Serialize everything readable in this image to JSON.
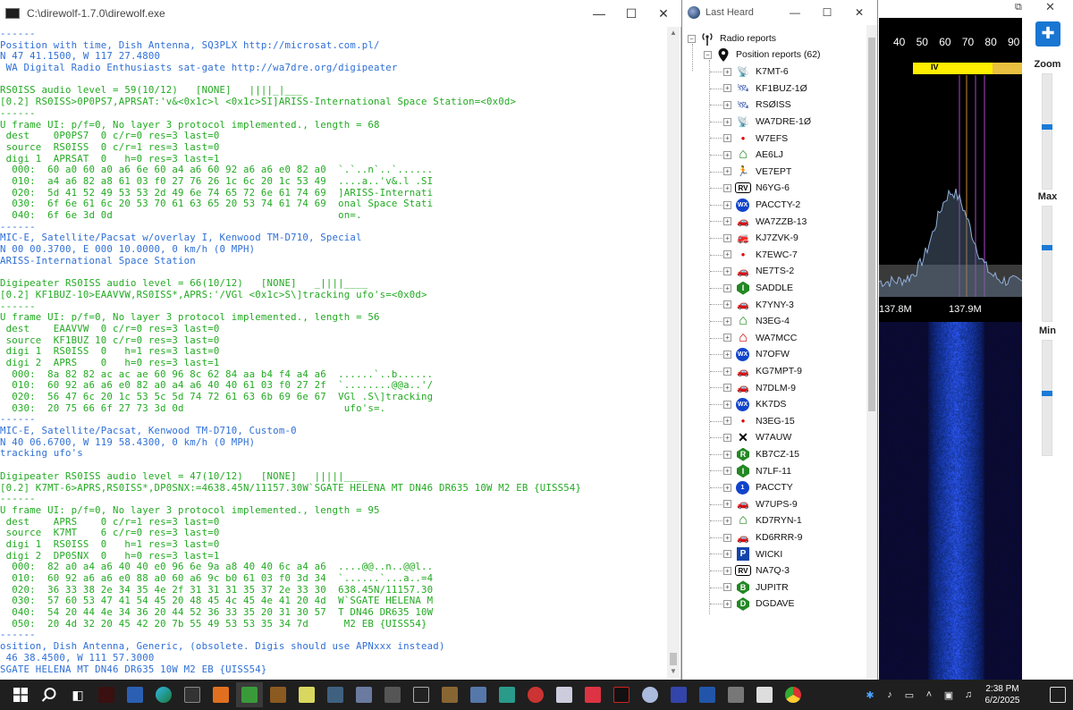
{
  "console": {
    "title": "C:\\direwolf-1.7.0\\direwolf.exe",
    "lines": [
      {
        "t": "------",
        "c": "blue"
      },
      {
        "t": "Position with time, Dish Antenna, SQ3PLX http://microsat.com.pl/",
        "c": "blue"
      },
      {
        "t": "N 47 41.1500, W 117 27.4800",
        "c": "blue"
      },
      {
        "t": " WA Digital Radio Enthusiasts sat-gate http://wa7dre.org/digipeater",
        "c": "blue"
      },
      {
        "t": "",
        "c": "blue"
      },
      {
        "t": "RS0ISS audio level = 59(10/12)   [NONE]   ||||_|___",
        "c": "green"
      },
      {
        "t": "[0.2] RS0ISS>0P0PS7,APRSAT:'v&<0x1c>l <0x1c>SI]ARISS-International Space Station=<0x0d>",
        "c": "green"
      },
      {
        "t": "------",
        "c": "green"
      },
      {
        "t": "U frame UI: p/f=0, No layer 3 protocol implemented., length = 68",
        "c": "green"
      },
      {
        "t": " dest    0P0PS7  0 c/r=0 res=3 last=0",
        "c": "green"
      },
      {
        "t": " source  RS0ISS  0 c/r=1 res=3 last=0",
        "c": "green"
      },
      {
        "t": " digi 1  APRSAT  0   h=0 res=3 last=1",
        "c": "green"
      },
      {
        "t": "  000:  60 a0 60 a0 a6 6e 60 a4 a6 60 92 a6 a6 e0 82 a0  `.`..n`..`......",
        "c": "green"
      },
      {
        "t": "  010:  a4 a6 82 a8 61 03 f0 27 76 26 1c 6c 20 1c 53 49  ....a..'v&.l .SI",
        "c": "green"
      },
      {
        "t": "  020:  5d 41 52 49 53 53 2d 49 6e 74 65 72 6e 61 74 69  ]ARISS-Internati",
        "c": "green"
      },
      {
        "t": "  030:  6f 6e 61 6c 20 53 70 61 63 65 20 53 74 61 74 69  onal Space Stati",
        "c": "green"
      },
      {
        "t": "  040:  6f 6e 3d 0d                                      on=.",
        "c": "green"
      },
      {
        "t": "------",
        "c": "blue"
      },
      {
        "t": "MIC-E, Satellite/Pacsat w/overlay I, Kenwood TM-D710, Special",
        "c": "blue"
      },
      {
        "t": "N 00 00.3700, E 000 10.0000, 0 km/h (0 MPH)",
        "c": "blue"
      },
      {
        "t": "ARISS-International Space Station",
        "c": "blue"
      },
      {
        "t": "",
        "c": "blue"
      },
      {
        "t": "Digipeater RS0ISS audio level = 66(10/12)   [NONE]   _||||____",
        "c": "green"
      },
      {
        "t": "[0.2] KF1BUZ-10>EAAVVW,RS0ISS*,APRS:'/VGl <0x1c>S\\]tracking ufo's=<0x0d>",
        "c": "green"
      },
      {
        "t": "------",
        "c": "green"
      },
      {
        "t": "U frame UI: p/f=0, No layer 3 protocol implemented., length = 56",
        "c": "green"
      },
      {
        "t": " dest    EAAVVW  0 c/r=0 res=3 last=0",
        "c": "green"
      },
      {
        "t": " source  KF1BUZ 10 c/r=0 res=3 last=0",
        "c": "green"
      },
      {
        "t": " digi 1  RS0ISS  0   h=1 res=3 last=0",
        "c": "green"
      },
      {
        "t": " digi 2  APRS    0   h=0 res=3 last=1",
        "c": "green"
      },
      {
        "t": "  000:  8a 82 82 ac ac ae 60 96 8c 62 84 aa b4 f4 a4 a6  ......`..b......",
        "c": "green"
      },
      {
        "t": "  010:  60 92 a6 a6 e0 82 a0 a4 a6 40 40 61 03 f0 27 2f  `........@@a..'/",
        "c": "green"
      },
      {
        "t": "  020:  56 47 6c 20 1c 53 5c 5d 74 72 61 63 6b 69 6e 67  VGl .S\\]tracking",
        "c": "green"
      },
      {
        "t": "  030:  20 75 66 6f 27 73 3d 0d                           ufo's=.",
        "c": "green"
      },
      {
        "t": "------",
        "c": "blue"
      },
      {
        "t": "MIC-E, Satellite/Pacsat, Kenwood TM-D710, Custom-0",
        "c": "blue"
      },
      {
        "t": "N 40 06.6700, W 119 58.4300, 0 km/h (0 MPH)",
        "c": "blue"
      },
      {
        "t": "tracking ufo's",
        "c": "blue"
      },
      {
        "t": "",
        "c": "blue"
      },
      {
        "t": "Digipeater RS0ISS audio level = 47(10/12)   [NONE]   |||||____",
        "c": "green"
      },
      {
        "t": "[0.2] K7MT-6>APRS,RS0ISS*,DP0SNX:=4638.45N/11157.30W`SGATE HELENA MT DN46 DR635 10W M2 EB {UISS54}",
        "c": "green"
      },
      {
        "t": "------",
        "c": "green"
      },
      {
        "t": "U frame UI: p/f=0, No layer 3 protocol implemented., length = 95",
        "c": "green"
      },
      {
        "t": " dest    APRS    0 c/r=1 res=3 last=0",
        "c": "green"
      },
      {
        "t": " source  K7MT    6 c/r=0 res=3 last=0",
        "c": "green"
      },
      {
        "t": " digi 1  RS0ISS  0   h=1 res=3 last=0",
        "c": "green"
      },
      {
        "t": " digi 2  DP0SNX  0   h=0 res=3 last=1",
        "c": "green"
      },
      {
        "t": "  000:  82 a0 a4 a6 40 40 e0 96 6e 9a a8 40 40 6c a4 a6  ....@@..n..@@l..",
        "c": "green"
      },
      {
        "t": "  010:  60 92 a6 a6 e0 88 a0 60 a6 9c b0 61 03 f0 3d 34  `......`...a..=4",
        "c": "green"
      },
      {
        "t": "  020:  36 33 38 2e 34 35 4e 2f 31 31 31 35 37 2e 33 30  638.45N/11157.30",
        "c": "green"
      },
      {
        "t": "  030:  57 60 53 47 41 54 45 20 48 45 4c 45 4e 41 20 4d  W`SGATE HELENA M",
        "c": "green"
      },
      {
        "t": "  040:  54 20 44 4e 34 36 20 44 52 36 33 35 20 31 30 57  T DN46 DR635 10W",
        "c": "green"
      },
      {
        "t": "  050:  20 4d 32 20 45 42 20 7b 55 49 53 53 35 34 7d      M2 EB {UISS54}",
        "c": "green"
      },
      {
        "t": "------",
        "c": "blue"
      },
      {
        "t": "osition, Dish Antenna, Generic, (obsolete. Digis should use APNxxx instead)",
        "c": "blue"
      },
      {
        "t": " 46 38.4500, W 111 57.3000",
        "c": "blue"
      },
      {
        "t": "SGATE HELENA MT DN46 DR635 10W M2 EB {UISS54}",
        "c": "blue"
      }
    ]
  },
  "last_heard": {
    "title": "Last Heard",
    "root_label": "Radio reports",
    "group_label": "Position reports (62)",
    "stations": [
      {
        "call": "K7MT-6",
        "icon": "satellite-dish-icon",
        "glyph": "📡",
        "color": "#3355aa"
      },
      {
        "call": "KF1BUZ-1Ø",
        "icon": "satellite-icon",
        "glyph": "🛰",
        "color": "#3355aa"
      },
      {
        "call": "RSØISS",
        "icon": "satellite-icon",
        "glyph": "🛰",
        "color": "#3355aa"
      },
      {
        "call": "WA7DRE-1Ø",
        "icon": "satellite-dish-icon",
        "glyph": "📡",
        "color": "#3355aa"
      },
      {
        "call": "W7EFS",
        "icon": "red-dot-icon",
        "glyph": "●",
        "color": "#dd0000"
      },
      {
        "call": "AE6LJ",
        "icon": "house-icon",
        "glyph": "⌂",
        "color": "#228822"
      },
      {
        "call": "VE7EPT",
        "icon": "jogger-icon",
        "glyph": "🏃",
        "color": "#aa00aa"
      },
      {
        "call": "N6YG-6",
        "icon": "rv-icon",
        "glyph": "RV",
        "color": "#000000"
      },
      {
        "call": "PACCTY-2",
        "icon": "wx-icon",
        "glyph": "WX",
        "color": "#1144cc"
      },
      {
        "call": "WA7ZZB-13",
        "icon": "car-icon",
        "glyph": "🚗",
        "color": "#cc0000"
      },
      {
        "call": "KJ7ZVK-9",
        "icon": "fire-truck-icon",
        "glyph": "🚒",
        "color": "#cc0000"
      },
      {
        "call": "K7EWC-7",
        "icon": "red-dot-icon",
        "glyph": "●",
        "color": "#dd0000"
      },
      {
        "call": "NE7TS-2",
        "icon": "car-icon",
        "glyph": "🚗",
        "color": "#cc0000"
      },
      {
        "call": "SADDLE",
        "icon": "igate-icon",
        "glyph": "I",
        "color": "#228822"
      },
      {
        "call": "K7YNY-3",
        "icon": "car-icon",
        "glyph": "🚗",
        "color": "#cc0000"
      },
      {
        "call": "N3EG-4",
        "icon": "house-icon",
        "glyph": "⌂",
        "color": "#228822"
      },
      {
        "call": "WA7MCC",
        "icon": "house-icon",
        "glyph": "⌂",
        "color": "#cc0000"
      },
      {
        "call": "N7OFW",
        "icon": "wx-icon",
        "glyph": "WX",
        "color": "#1144cc"
      },
      {
        "call": "KG7MPT-9",
        "icon": "car-icon",
        "glyph": "🚗",
        "color": "#555555"
      },
      {
        "call": "N7DLM-9",
        "icon": "car-icon",
        "glyph": "🚗",
        "color": "#cc0000"
      },
      {
        "call": "KK7DS",
        "icon": "wx-icon",
        "glyph": "WX",
        "color": "#1144cc"
      },
      {
        "call": "N3EG-15",
        "icon": "red-dot-icon",
        "glyph": "●",
        "color": "#dd0000"
      },
      {
        "call": "W7AUW",
        "icon": "x-icon",
        "glyph": "✕",
        "color": "#000000"
      },
      {
        "call": "KB7CZ-15",
        "icon": "digi-icon",
        "glyph": "R",
        "color": "#228822"
      },
      {
        "call": "N7LF-11",
        "icon": "igate-icon",
        "glyph": "I",
        "color": "#228822"
      },
      {
        "call": "PACCTY",
        "icon": "number-one-icon",
        "glyph": "1",
        "color": "#1144cc"
      },
      {
        "call": "W7UPS-9",
        "icon": "car-icon",
        "glyph": "🚗",
        "color": "#228822"
      },
      {
        "call": "KD7RYN-1",
        "icon": "house-icon",
        "glyph": "⌂",
        "color": "#228822"
      },
      {
        "call": "KD6RRR-9",
        "icon": "car-icon",
        "glyph": "🚗",
        "color": "#555555"
      },
      {
        "call": "WICKI",
        "icon": "parking-icon",
        "glyph": "P",
        "color": "#1144aa"
      },
      {
        "call": "NA7Q-3",
        "icon": "rv-icon",
        "glyph": "RV",
        "color": "#000000"
      },
      {
        "call": "JUPITR",
        "icon": "digi-icon",
        "glyph": "B",
        "color": "#228822"
      },
      {
        "call": "DGDAVE",
        "icon": "digi-icon",
        "glyph": "D",
        "color": "#228822"
      }
    ]
  },
  "sdr": {
    "scale_ticks": [
      "40",
      "50",
      "60",
      "70",
      "80",
      "90"
    ],
    "band_label": "IV",
    "freq_labels": [
      "137.8M",
      "137.9M"
    ],
    "zoom_label": "Zoom",
    "max_label": "Max",
    "min_label": "Min",
    "zoom_level": 0.45,
    "max_level": 0.35,
    "min_level": 0.45
  },
  "taskbar": {
    "time": "2:38 PM",
    "date": "6/2/2025"
  }
}
